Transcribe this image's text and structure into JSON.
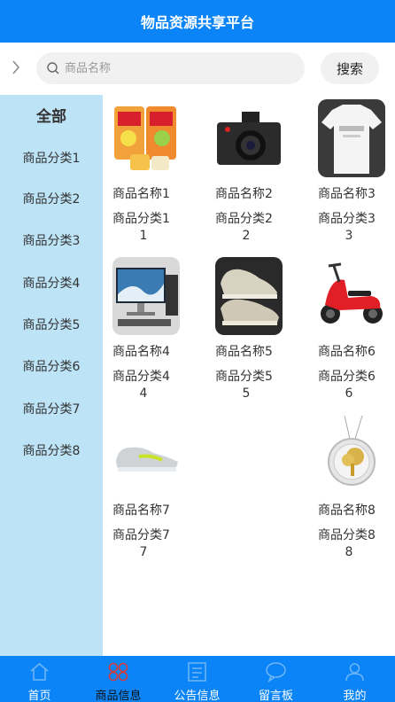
{
  "header": {
    "title": "物品资源共享平台"
  },
  "search": {
    "placeholder": "商品名称",
    "button_label": "搜索"
  },
  "sidebar": {
    "all_label": "全部",
    "items": [
      "商品分类1",
      "商品分类2",
      "商品分类3",
      "商品分类4",
      "商品分类5",
      "商品分类6",
      "商品分类7",
      "商品分类8"
    ]
  },
  "products": [
    {
      "name": "商品名称1",
      "category": "商品分类1",
      "num": "1",
      "image": "snacks"
    },
    {
      "name": "商品名称2",
      "category": "商品分类2",
      "num": "2",
      "image": "camera"
    },
    {
      "name": "商品名称3",
      "category": "商品分类3",
      "num": "3",
      "image": "tshirt"
    },
    {
      "name": "商品名称4",
      "category": "商品分类4",
      "num": "4",
      "image": "computer"
    },
    {
      "name": "商品名称5",
      "category": "商品分类5",
      "num": "5",
      "image": "sneaker"
    },
    {
      "name": "商品名称6",
      "category": "商品分类6",
      "num": "6",
      "image": "scooter"
    },
    {
      "name": "商品名称7",
      "category": "商品分类7",
      "num": "7",
      "image": "running-shoe"
    },
    {
      "name": "商品名称8",
      "category": "商品分类8",
      "num": "8",
      "image": "tree-pendant"
    }
  ],
  "tabbar": {
    "items": [
      {
        "label": "首页",
        "icon": "home-icon"
      },
      {
        "label": "商品信息",
        "icon": "product-icon",
        "active": true
      },
      {
        "label": "公告信息",
        "icon": "notice-icon"
      },
      {
        "label": "留言板",
        "icon": "message-icon"
      },
      {
        "label": "我的",
        "icon": "user-icon"
      }
    ]
  },
  "colors": {
    "primary": "#0a84f6",
    "sidebar": "#bde3f6",
    "search_bg": "#f1f1f1"
  }
}
